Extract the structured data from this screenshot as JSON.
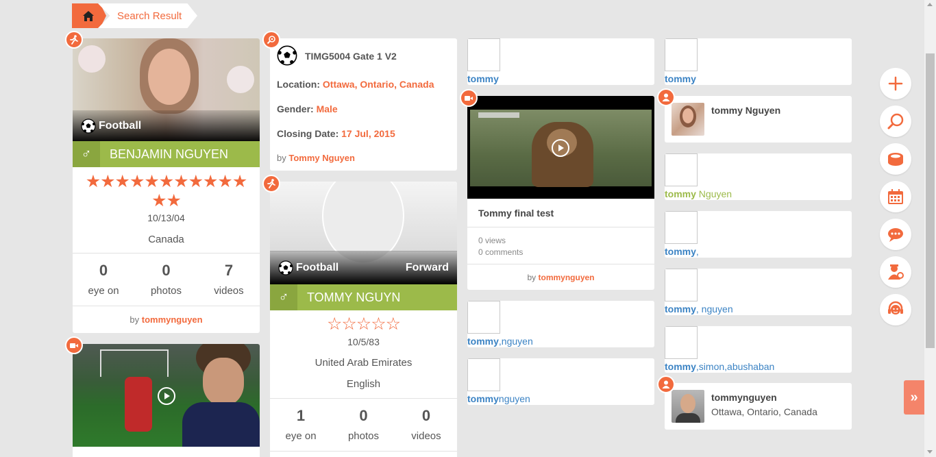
{
  "breadcrumb": {
    "current": "Search Result"
  },
  "player_card_1": {
    "sport": "Football",
    "name": "BENJAMIN NGUYEN",
    "rating_stars": 13,
    "dob": "10/13/04",
    "country": "Canada",
    "stats": [
      {
        "value": "0",
        "label": "eye on"
      },
      {
        "value": "0",
        "label": "photos"
      },
      {
        "value": "7",
        "label": "videos"
      }
    ],
    "by_label": "by",
    "by_user": "tommynguyen"
  },
  "event_card": {
    "title": "TIMG5004 Gate 1 V2",
    "location_label": "Location:",
    "location": "Ottawa, Ontario, Canada",
    "gender_label": "Gender:",
    "gender": "Male",
    "closing_label": "Closing Date:",
    "closing_date": "17 Jul, 2015",
    "by_label": "by",
    "by_user": "Tommy Nguyen"
  },
  "player_card_2": {
    "sport": "Football",
    "position": "Forward",
    "name": "TOMMY NGUYN",
    "rating_stars": 0,
    "dob": "10/5/83",
    "country": "United Arab Emirates",
    "language": "English",
    "stats": [
      {
        "value": "1",
        "label": "eye on"
      },
      {
        "value": "0",
        "label": "photos"
      },
      {
        "value": "0",
        "label": "videos"
      }
    ]
  },
  "video_card": {
    "title": "Tommy final test",
    "views": "0 views",
    "comments": "0 comments",
    "by_label": "by",
    "by_user": "tommynguyen"
  },
  "col3_users": [
    {
      "first": "tommy",
      "rest": ""
    },
    {
      "first": "tommy",
      "rest": ",nguyen"
    },
    {
      "first": "tommy",
      "rest": "nguyen"
    }
  ],
  "col4_users": [
    {
      "first": "tommy",
      "rest": ""
    },
    {
      "first": "tommy",
      "rest": " Nguyen"
    },
    {
      "first": "tommy",
      "rest": ","
    },
    {
      "first": "tommy",
      "rest": ", nguyen"
    },
    {
      "first": "tommy",
      "rest": ",simon,abushaban"
    }
  ],
  "user_card_1": {
    "name": "tommy Nguyen"
  },
  "user_card_2": {
    "name": "tommynguyen",
    "location": "Ottawa, Ontario, Canada"
  },
  "colors": {
    "accent": "#f26a3d",
    "green": "#9cba4a",
    "link": "#3b83c4"
  }
}
